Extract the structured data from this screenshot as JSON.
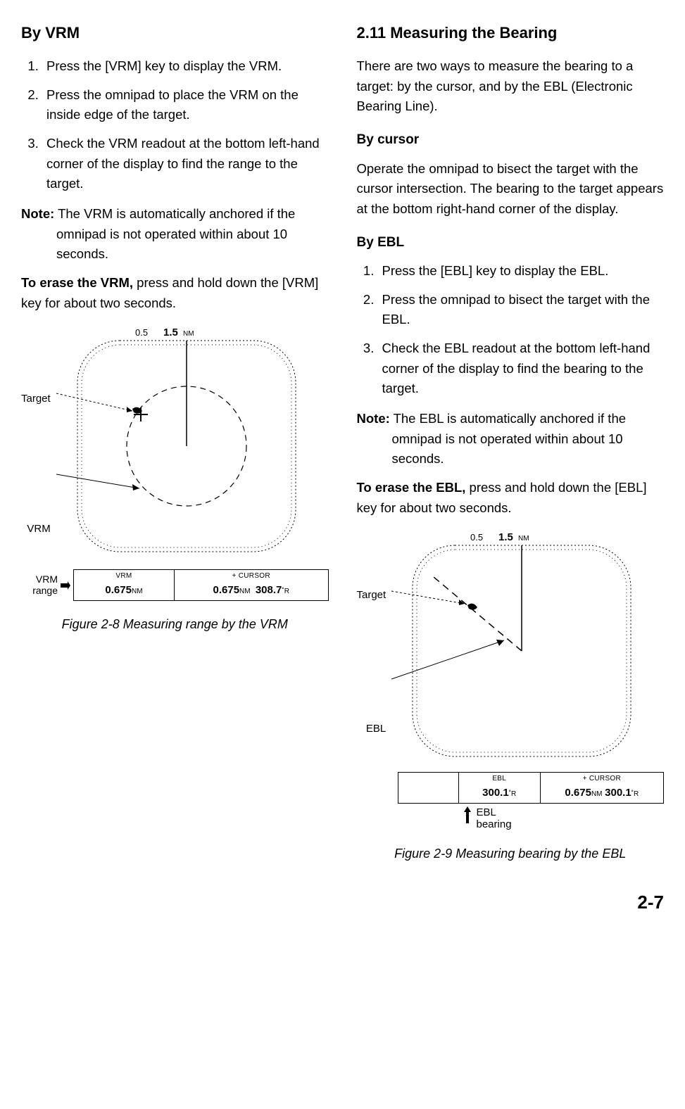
{
  "page_number": "2-7",
  "left": {
    "heading": "By VRM",
    "steps": [
      "Press the [VRM] key to display the VRM.",
      "Press the omnipad to place the VRM on the inside edge of the target.",
      "Check the VRM readout at the bottom left-hand corner of the display to find the range to the target."
    ],
    "note_lead": "Note:",
    "note_body": " The VRM is automatically anchored if the omnipad is not operated within about 10 seconds.",
    "erase_lead": "To erase the VRM,",
    "erase_body": " press and hold down the [VRM] key for about two seconds.",
    "fig": {
      "scale_small": "0.5",
      "scale_big": "1.5",
      "scale_unit": "NM",
      "label_target": "Target",
      "label_vrm": "VRM",
      "label_vrm_range": "VRM\nrange",
      "readout_vrm_header": "VRM",
      "readout_vrm_value": "0.675",
      "readout_vrm_unit": "NM",
      "readout_cursor_header": "+ CURSOR",
      "readout_cursor_rng": "0.675",
      "readout_cursor_rng_unit": "NM",
      "readout_cursor_brg": "308.7",
      "readout_cursor_brg_unit": "˚R",
      "caption": "Figure 2-8 Measuring range by the VRM"
    }
  },
  "right": {
    "heading": "2.11 Measuring the Bearing",
    "intro": "There are two ways to measure the bearing to a target: by the cursor, and by the EBL (Electronic Bearing Line).",
    "sub_cursor": "By cursor",
    "cursor_body": "Operate the omnipad to bisect the target with the cursor intersection. The bearing to the target appears at the bottom right-hand corner of the display.",
    "sub_ebl": "By EBL",
    "steps": [
      "Press the [EBL] key to display the EBL.",
      "Press the omnipad to bisect the target with the EBL.",
      "Check the EBL readout at the bottom left-hand corner of the display to find the bearing to the target."
    ],
    "note_lead": "Note:",
    "note_body": " The EBL is automatically anchored if the omnipad is not operated within about 10 seconds.",
    "erase_lead": "To erase the EBL,",
    "erase_body": " press and hold down the [EBL] key for about two seconds.",
    "fig": {
      "scale_small": "0.5",
      "scale_big": "1.5",
      "scale_unit": "NM",
      "label_target": "Target",
      "label_ebl": "EBL",
      "label_ebl_bearing": "EBL\nbearing",
      "readout_ebl_header": "EBL",
      "readout_ebl_value": "300.1",
      "readout_ebl_unit": "˚R",
      "readout_cursor_header": "+ CURSOR",
      "readout_cursor_rng": "0.675",
      "readout_cursor_rng_unit": "NM",
      "readout_cursor_brg": "300.1",
      "readout_cursor_brg_unit": "˚R",
      "caption": "Figure 2-9 Measuring bearing by the EBL"
    }
  }
}
